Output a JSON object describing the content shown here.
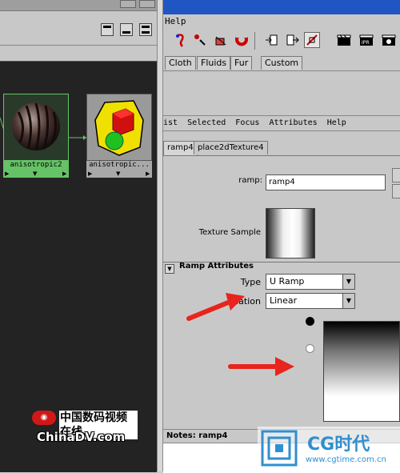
{
  "left": {
    "nodes": [
      {
        "label": "anisotropic2",
        "ports": [
          "▶",
          "▼",
          "▶"
        ]
      },
      {
        "label": "anisotropic...",
        "ports": [
          "▶",
          "▼",
          "▶"
        ]
      }
    ]
  },
  "right": {
    "menu_help": "Help",
    "shelf_tabs": [
      "Cloth",
      "Fluids",
      "Fur",
      "Custom"
    ],
    "ae_menu": [
      "ist",
      "Selected",
      "Focus",
      "Attributes",
      "Help"
    ],
    "ae_tabs": [
      "ramp4",
      "place2dTexture4"
    ],
    "ramp_label": "ramp:",
    "ramp_value": "ramp4",
    "texture_sample_label": "Texture Sample",
    "section_title": "Ramp Attributes",
    "type_label": "Type",
    "type_value": "U Ramp",
    "interp_label": "olation",
    "interp_value": "Linear",
    "notes_label": "Notes: ramp4",
    "dropdown_arrow": "▼"
  },
  "watermarks": {
    "chinadv_cn": "中国数码视频在线",
    "chinadv_en": "ChinaDV.com",
    "cgtime_title": "CG时代",
    "cgtime_url": "www.cgtime.com.cn"
  },
  "colors": {
    "title_blue": "#1f56c4",
    "node_green": "#66c266",
    "node_gray": "#a8a8a8",
    "arrow_red": "#e8241c"
  }
}
